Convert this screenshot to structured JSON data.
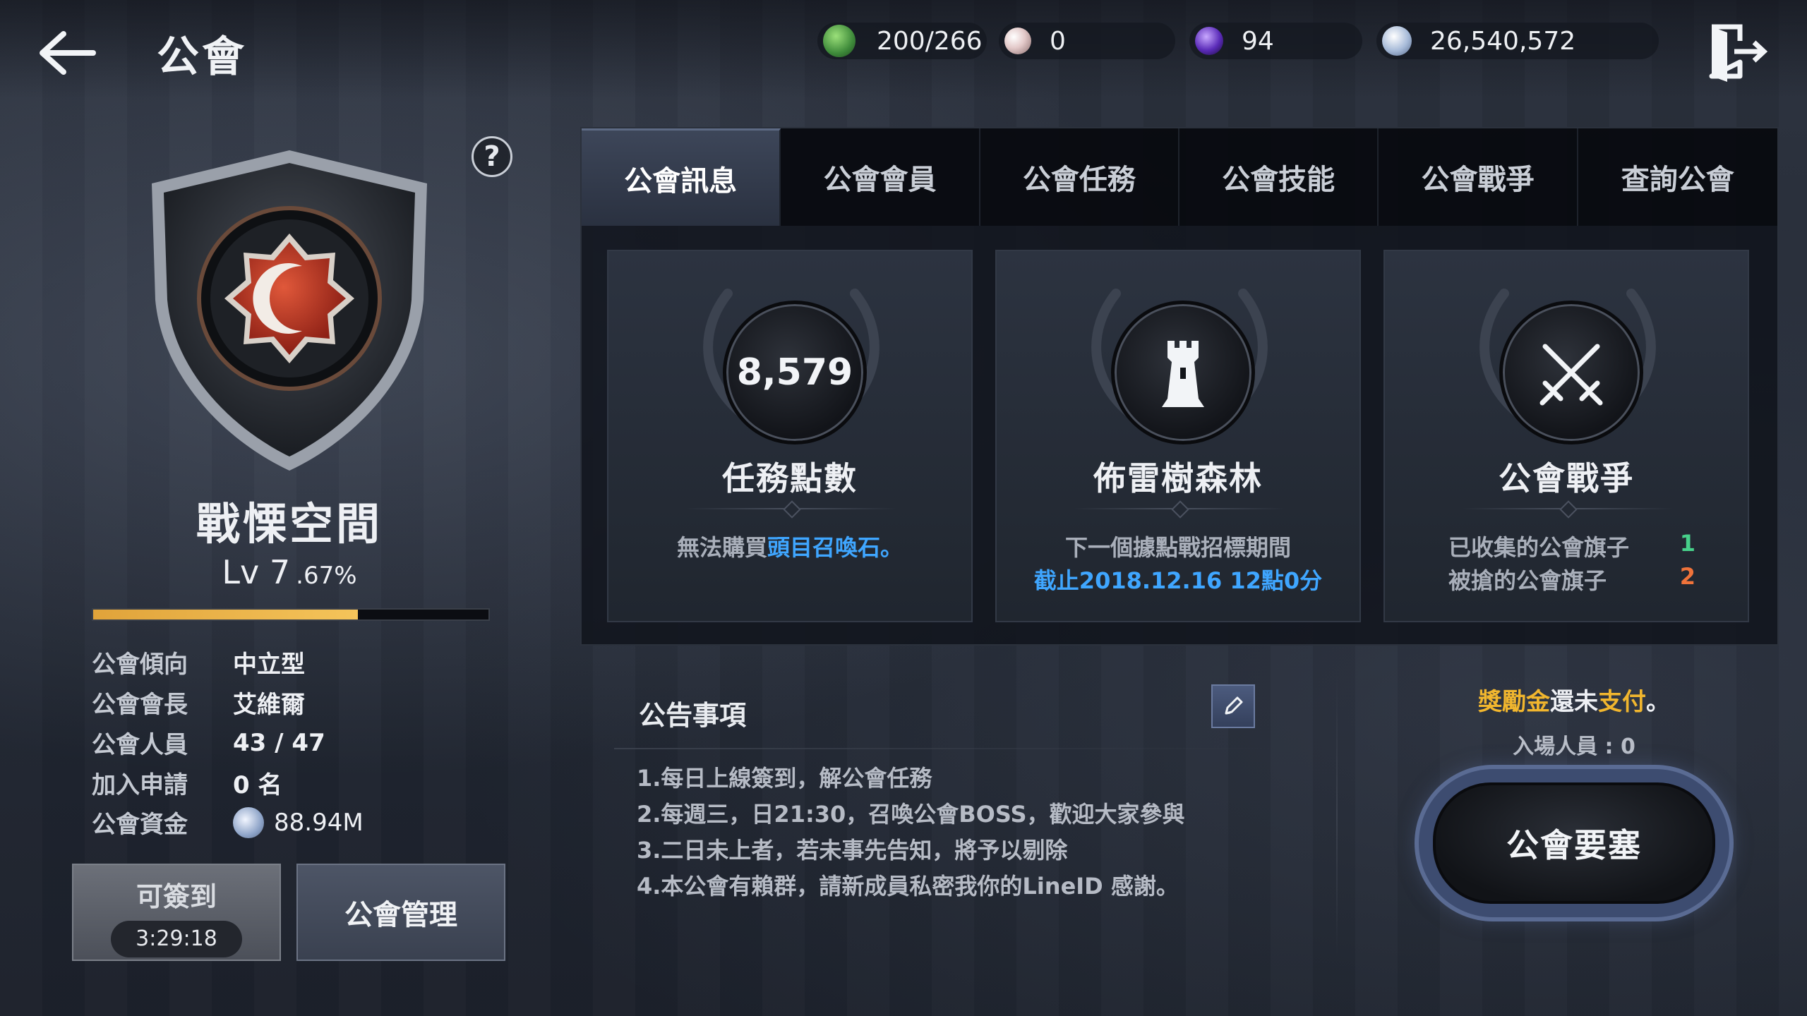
{
  "header": {
    "title": "公會",
    "currencies": [
      {
        "icon": "green-stone-icon",
        "value": "200/266",
        "color": "#4a9a4a"
      },
      {
        "icon": "pearl-icon",
        "value": "0",
        "color": "#e3c9c9"
      },
      {
        "icon": "purple-gem-icon",
        "value": "94",
        "color": "#6b3ad0"
      },
      {
        "icon": "silver-coin-icon",
        "value": "26,540,572",
        "color": "#9fb4d6"
      }
    ]
  },
  "guild": {
    "name": "戰慄空間",
    "level": "Lv 7",
    "progress_pct": ".67%",
    "progress_fraction": 0.67,
    "info": [
      {
        "label": "公會傾向",
        "value": "中立型"
      },
      {
        "label": "公會會長",
        "value": "艾維爾"
      },
      {
        "label": "公會人員",
        "value": "43 / 47"
      },
      {
        "label": "加入申請",
        "value": "0 名"
      },
      {
        "label": "公會資金",
        "value": "88.94M"
      }
    ],
    "checkin_label": "可簽到",
    "checkin_timer": "3:29:18",
    "manage_label": "公會管理",
    "help_label": "?"
  },
  "tabs": [
    "公會訊息",
    "公會會員",
    "公會任務",
    "公會技能",
    "公會戰爭",
    "查詢公會"
  ],
  "cards": {
    "mission": {
      "value": "8,579",
      "title": "任務點數",
      "desc_prefix": "無法購買",
      "desc_highlight": "頭目召喚石。"
    },
    "forest": {
      "title": "佈雷樹森林",
      "line1": "下一個據點戰招標期間",
      "line2": "截止2018.12.16 12點0分"
    },
    "war": {
      "title": "公會戰爭",
      "collected_label": "已收集的公會旗子",
      "collected_value": "1",
      "stolen_label": "被搶的公會旗子",
      "stolen_value": "2"
    }
  },
  "notice": {
    "title": "公告事項",
    "lines": [
      "1.每日上線簽到，解公會任務",
      "2.每週三，日21:30，召喚公會BOSS，歡迎大家參與",
      "3.二日未上者，若未事先告知，將予以剔除",
      "4.本公會有賴群，請新成員私密我你的LineID 感謝。"
    ]
  },
  "fortress": {
    "bonus_part1": "獎勵金",
    "bonus_part2": "還未",
    "bonus_part3": "支付",
    "bonus_part4": "。",
    "entrants": "入場人員 : 0",
    "button_label": "公會要塞"
  },
  "colors": {
    "accent_blue": "#3fa6ff",
    "gold": "#f1b62e",
    "green": "#47d08a",
    "orange": "#f0733a",
    "xp_bar": "#f5c45a"
  }
}
